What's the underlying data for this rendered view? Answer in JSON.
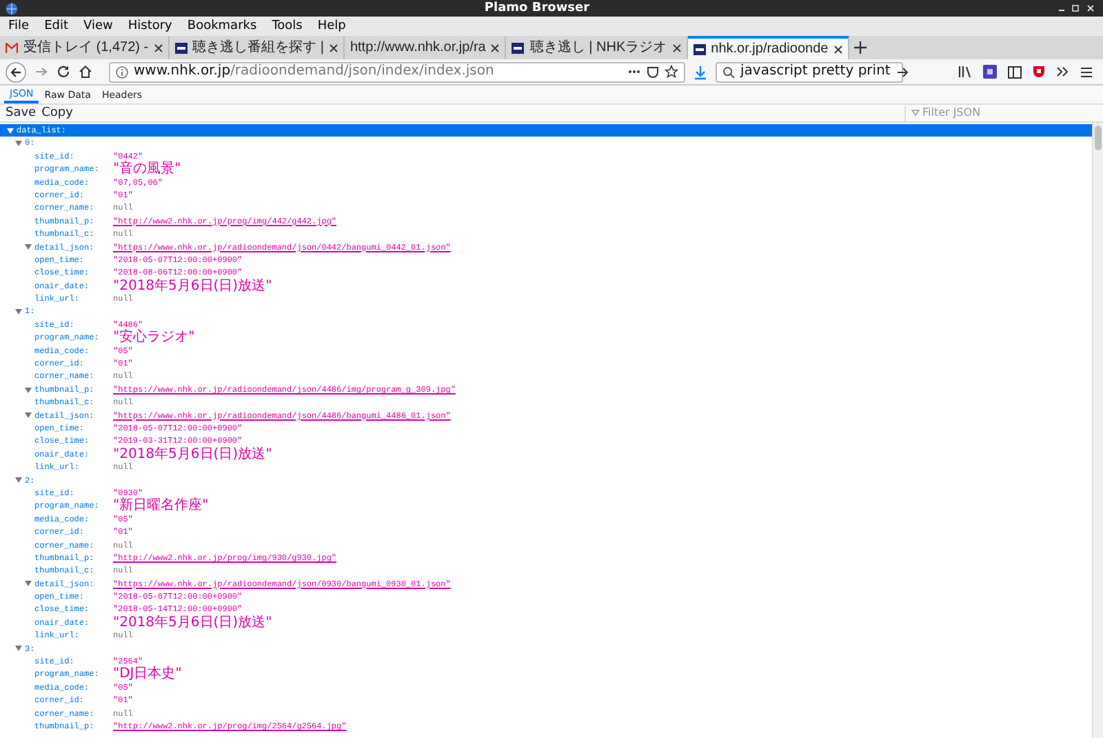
{
  "window": {
    "title": "Plamo Browser"
  },
  "menu": [
    "File",
    "Edit",
    "View",
    "History",
    "Bookmarks",
    "Tools",
    "Help"
  ],
  "tabs": [
    {
      "label": "受信トレイ (1,472) -",
      "selected": false
    },
    {
      "label": "聴き逃し番組を探す |",
      "selected": false
    },
    {
      "label": "http://www.nhk.or.jp/ra",
      "selected": false
    },
    {
      "label": "聴き逃し | NHKラジオ",
      "selected": false
    },
    {
      "label": "nhk.or.jp/radioonde",
      "selected": true
    }
  ],
  "address": {
    "host": "www.nhk.or.jp",
    "path": "/radioondemand/json/index/index.json"
  },
  "search": {
    "value": "javascript pretty print"
  },
  "viewer_tabs": [
    {
      "label": "JSON",
      "selected": true
    },
    {
      "label": "Raw Data",
      "selected": false
    },
    {
      "label": "Headers",
      "selected": false
    }
  ],
  "toolbar": {
    "buttons": [
      "Save",
      "Copy"
    ],
    "filter": {
      "placeholder": "Filter JSON"
    }
  },
  "tree": {
    "key": "data_list:",
    "selected": true,
    "children": [
      {
        "key": "0:",
        "selected": false,
        "props": [
          {
            "key": "site_id:",
            "value": "\"0442\"",
            "kind": "string"
          },
          {
            "key": "program_name:",
            "value": "\"音の風景\"",
            "kind": "string"
          },
          {
            "key": "media_code:",
            "value": "\"07,05,06\"",
            "kind": "string"
          },
          {
            "key": "corner_id:",
            "value": "\"01\"",
            "kind": "string"
          },
          {
            "key": "corner_name:",
            "value": "null",
            "kind": "null"
          },
          {
            "key": "thumbnail_p:",
            "value": "\"http://www2.nhk.or.jp/prog/img/442/g442.jpg\"",
            "kind": "link"
          },
          {
            "key": "thumbnail_c:",
            "value": "null",
            "kind": "null"
          },
          {
            "key": "detail_json:",
            "value": "\"https://www.nhk.or.jp/radioondemand/json/0442/bangumi_0442_01.json\"",
            "kind": "link",
            "expandable": true
          },
          {
            "key": "open_time:",
            "value": "\"2018-05-07T12:00:00+0900\"",
            "kind": "string"
          },
          {
            "key": "close_time:",
            "value": "\"2018-08-06T12:00:00+0900\"",
            "kind": "string"
          },
          {
            "key": "onair_date:",
            "value": "\"2018年5月6日(日)放送\"",
            "kind": "string"
          },
          {
            "key": "link_url:",
            "value": "null",
            "kind": "null"
          }
        ]
      },
      {
        "key": "1:",
        "selected": false,
        "props": [
          {
            "key": "site_id:",
            "value": "\"4486\"",
            "kind": "string"
          },
          {
            "key": "program_name:",
            "value": "\"安心ラジオ\"",
            "kind": "string"
          },
          {
            "key": "media_code:",
            "value": "\"05\"",
            "kind": "string"
          },
          {
            "key": "corner_id:",
            "value": "\"01\"",
            "kind": "string"
          },
          {
            "key": "corner_name:",
            "value": "null",
            "kind": "null"
          },
          {
            "key": "thumbnail_p:",
            "value": "\"https://www.nhk.or.jp/radioondemand/json/4486/img/program_g_309.jpg\"",
            "kind": "link",
            "expandable": true
          },
          {
            "key": "thumbnail_c:",
            "value": "null",
            "kind": "null"
          },
          {
            "key": "detail_json:",
            "value": "\"https://www.nhk.or.jp/radioondemand/json/4486/bangumi_4486_01.json\"",
            "kind": "link",
            "expandable": true
          },
          {
            "key": "open_time:",
            "value": "\"2018-05-07T12:00:00+0900\"",
            "kind": "string"
          },
          {
            "key": "close_time:",
            "value": "\"2019-03-31T12:00:00+0900\"",
            "kind": "string"
          },
          {
            "key": "onair_date:",
            "value": "\"2018年5月6日(日)放送\"",
            "kind": "string"
          },
          {
            "key": "link_url:",
            "value": "null",
            "kind": "null"
          }
        ]
      },
      {
        "key": "2:",
        "selected": false,
        "props": [
          {
            "key": "site_id:",
            "value": "\"0930\"",
            "kind": "string"
          },
          {
            "key": "program_name:",
            "value": "\"新日曜名作座\"",
            "kind": "string"
          },
          {
            "key": "media_code:",
            "value": "\"05\"",
            "kind": "string"
          },
          {
            "key": "corner_id:",
            "value": "\"01\"",
            "kind": "string"
          },
          {
            "key": "corner_name:",
            "value": "null",
            "kind": "null"
          },
          {
            "key": "thumbnail_p:",
            "value": "\"http://www2.nhk.or.jp/prog/img/930/g930.jpg\"",
            "kind": "link"
          },
          {
            "key": "thumbnail_c:",
            "value": "null",
            "kind": "null"
          },
          {
            "key": "detail_json:",
            "value": "\"https://www.nhk.or.jp/radioondemand/json/0930/bangumi_0930_01.json\"",
            "kind": "link",
            "expandable": true
          },
          {
            "key": "open_time:",
            "value": "\"2018-05-07T12:00:00+0900\"",
            "kind": "string"
          },
          {
            "key": "close_time:",
            "value": "\"2018-05-14T12:00:00+0900\"",
            "kind": "string"
          },
          {
            "key": "onair_date:",
            "value": "\"2018年5月6日(日)放送\"",
            "kind": "string"
          },
          {
            "key": "link_url:",
            "value": "null",
            "kind": "null"
          }
        ]
      },
      {
        "key": "3:",
        "selected": false,
        "props": [
          {
            "key": "site_id:",
            "value": "\"2564\"",
            "kind": "string"
          },
          {
            "key": "program_name:",
            "value": "\"DJ日本史\"",
            "kind": "string"
          },
          {
            "key": "media_code:",
            "value": "\"05\"",
            "kind": "string"
          },
          {
            "key": "corner_id:",
            "value": "\"01\"",
            "kind": "string"
          },
          {
            "key": "corner_name:",
            "value": "null",
            "kind": "null"
          },
          {
            "key": "thumbnail_p:",
            "value": "\"http://www2.nhk.or.jp/prog/img/2564/g2564.jpg\"",
            "kind": "link"
          }
        ]
      }
    ]
  }
}
